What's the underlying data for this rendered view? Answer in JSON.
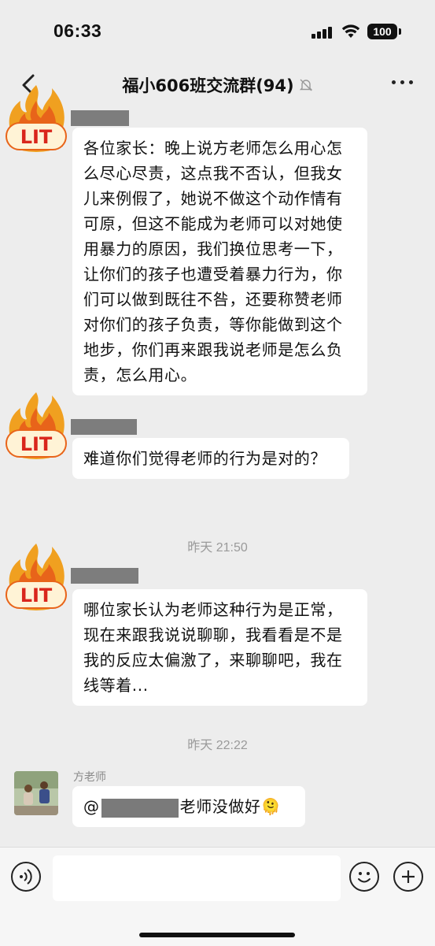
{
  "status_bar": {
    "time": "06:33",
    "battery": "100"
  },
  "header": {
    "title": "福小606班交流群(94)"
  },
  "icons": {
    "back": "chevron-left-icon",
    "mute": "bell-off-icon",
    "more": "more-dots-icon",
    "voice": "voice-icon",
    "emoji": "smile-icon",
    "plus": "plus-icon"
  },
  "avatar_sticker": {
    "text": "LIT"
  },
  "messages": [
    {
      "text": "各位家长：晚上说方老师怎么用心怎么尽心尽责，这点我不否认，但我女儿来例假了，她说不做这个动作情有可原，但这不能成为老师可以对她使用暴力的原因，我们换位思考一下，让你们的孩子也遭受着暴力行为，你们可以做到既往不咎，还要称赞老师对你们的孩子负责，等你能做到这个地步，你们再来跟我说老师是怎么负责，怎么用心。"
    },
    {
      "text": "难道你们觉得老师的行为是对的？"
    },
    {
      "timestamp": "昨天 21:50"
    },
    {
      "text": "哪位家长认为老师这种行为是正常，现在来跟我说说聊聊，我看看是不是我的反应太偏激了，来聊聊吧，我在线等着..."
    },
    {
      "timestamp": "昨天 22:22"
    },
    {
      "sender": "方老师",
      "prefix": "@",
      "suffix": "老师没做好",
      "emoji": "🫠"
    }
  ],
  "colors": {
    "background": "#ededed",
    "bubble": "#ffffff",
    "redaction": "#7d7d7d",
    "flame_outer": "#f0a020",
    "flame_inner": "#e8641a",
    "lit_text": "#d9261c"
  }
}
